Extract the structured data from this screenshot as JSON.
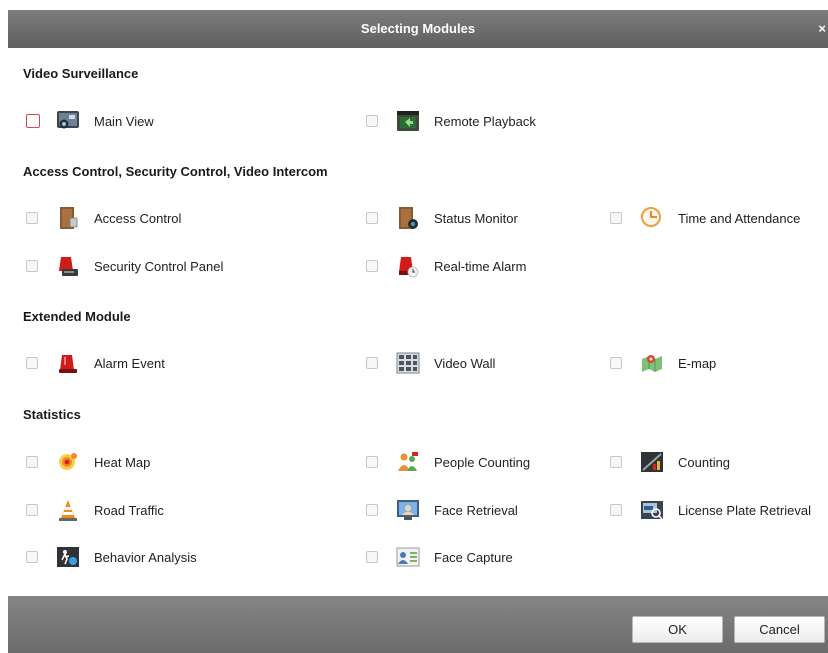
{
  "dialog": {
    "title": "Selecting Modules",
    "close_glyph": "×"
  },
  "sections": {
    "video_surveillance": {
      "title": "Video Surveillance",
      "items": [
        {
          "label": "Main View",
          "icon": "main-view-icon"
        },
        {
          "label": "Remote Playback",
          "icon": "remote-playback-icon"
        }
      ]
    },
    "access_control": {
      "title": "Access Control, Security Control, Video Intercom",
      "items": [
        {
          "label": "Access Control",
          "icon": "access-control-icon"
        },
        {
          "label": "Status Monitor",
          "icon": "status-monitor-icon"
        },
        {
          "label": "Time and Attendance",
          "icon": "time-attendance-icon"
        },
        {
          "label": "Security Control Panel",
          "icon": "security-control-panel-icon"
        },
        {
          "label": "Real-time Alarm",
          "icon": "realtime-alarm-icon"
        }
      ]
    },
    "extended": {
      "title": "Extended Module",
      "items": [
        {
          "label": "Alarm Event",
          "icon": "alarm-event-icon"
        },
        {
          "label": "Video Wall",
          "icon": "video-wall-icon"
        },
        {
          "label": "E-map",
          "icon": "emap-icon"
        }
      ]
    },
    "statistics": {
      "title": "Statistics",
      "items": [
        {
          "label": "Heat Map",
          "icon": "heat-map-icon"
        },
        {
          "label": "People Counting",
          "icon": "people-counting-icon"
        },
        {
          "label": "Counting",
          "icon": "counting-icon"
        },
        {
          "label": "Road Traffic",
          "icon": "road-traffic-icon"
        },
        {
          "label": "Face Retrieval",
          "icon": "face-retrieval-icon"
        },
        {
          "label": "License Plate Retrieval",
          "icon": "license-plate-retrieval-icon"
        },
        {
          "label": "Behavior Analysis",
          "icon": "behavior-analysis-icon"
        },
        {
          "label": "Face Capture",
          "icon": "face-capture-icon"
        }
      ]
    }
  },
  "footer": {
    "ok_label": "OK",
    "cancel_label": "Cancel"
  },
  "colors": {
    "titlebar": "#6e6e6e",
    "checkbox_focus": "#e0474c"
  }
}
